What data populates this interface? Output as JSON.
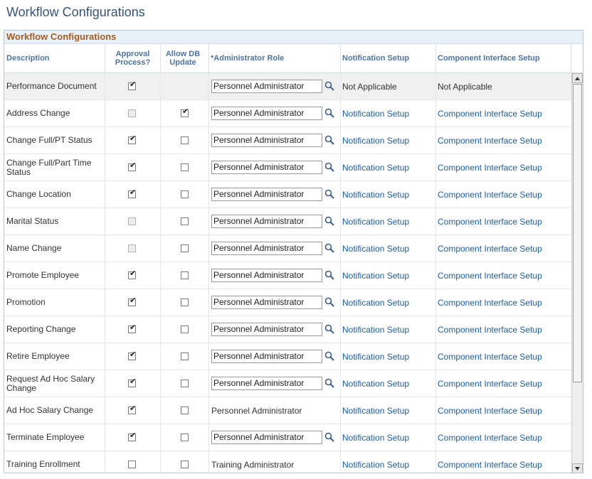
{
  "page": {
    "title": "Workflow Configurations"
  },
  "grid": {
    "title": "Workflow Configurations",
    "headers": {
      "description": "Description",
      "approval_line1": "Approval",
      "approval_line2": "Process?",
      "allow_line1": "Allow DB",
      "allow_line2": "Update",
      "admin_role": "*Administrator Role",
      "notification": "Notification Setup",
      "component": "Component Interface Setup"
    },
    "rows": [
      {
        "desc": "Performance Document",
        "approval": true,
        "approval_disabled": false,
        "allow_db": null,
        "role": "Personnel Administrator",
        "role_editable": true,
        "notification": "Not Applicable",
        "notification_link": false,
        "component": "Not Applicable",
        "component_link": false
      },
      {
        "desc": "Address Change",
        "approval": false,
        "approval_disabled": true,
        "allow_db": true,
        "role": "Personnel Administrator",
        "role_editable": true,
        "notification": "Notification Setup",
        "notification_link": true,
        "component": "Component Interface Setup",
        "component_link": true
      },
      {
        "desc": "Change Full/PT Status",
        "approval": true,
        "approval_disabled": false,
        "allow_db": false,
        "role": "Personnel Administrator",
        "role_editable": true,
        "notification": "Notification Setup",
        "notification_link": true,
        "component": "Component Interface Setup",
        "component_link": true
      },
      {
        "desc": "Change Full/Part Time Status",
        "approval": true,
        "approval_disabled": false,
        "allow_db": false,
        "role": "Personnel Administrator",
        "role_editable": true,
        "notification": "Notification Setup",
        "notification_link": true,
        "component": "Component Interface Setup",
        "component_link": true
      },
      {
        "desc": "Change Location",
        "approval": true,
        "approval_disabled": false,
        "allow_db": false,
        "role": "Personnel Administrator",
        "role_editable": true,
        "notification": "Notification Setup",
        "notification_link": true,
        "component": "Component Interface Setup",
        "component_link": true
      },
      {
        "desc": "Marital Status",
        "approval": false,
        "approval_disabled": true,
        "allow_db": false,
        "role": "Personnel Administrator",
        "role_editable": true,
        "notification": "Notification Setup",
        "notification_link": true,
        "component": "Component Interface Setup",
        "component_link": true
      },
      {
        "desc": "Name Change",
        "approval": false,
        "approval_disabled": true,
        "allow_db": false,
        "role": "Personnel Administrator",
        "role_editable": true,
        "notification": "Notification Setup",
        "notification_link": true,
        "component": "Component Interface Setup",
        "component_link": true
      },
      {
        "desc": "Promote Employee",
        "approval": true,
        "approval_disabled": false,
        "allow_db": false,
        "role": "Personnel Administrator",
        "role_editable": true,
        "notification": "Notification Setup",
        "notification_link": true,
        "component": "Component Interface Setup",
        "component_link": true
      },
      {
        "desc": "Promotion",
        "approval": true,
        "approval_disabled": false,
        "allow_db": false,
        "role": "Personnel Administrator",
        "role_editable": true,
        "notification": "Notification Setup",
        "notification_link": true,
        "component": "Component Interface Setup",
        "component_link": true
      },
      {
        "desc": "Reporting Change",
        "approval": true,
        "approval_disabled": false,
        "allow_db": false,
        "role": "Personnel Administrator",
        "role_editable": true,
        "notification": "Notification Setup",
        "notification_link": true,
        "component": "Component Interface Setup",
        "component_link": true
      },
      {
        "desc": "Retire Employee",
        "approval": true,
        "approval_disabled": false,
        "allow_db": false,
        "role": "Personnel Administrator",
        "role_editable": true,
        "notification": "Notification Setup",
        "notification_link": true,
        "component": "Component Interface Setup",
        "component_link": true
      },
      {
        "desc": "Request Ad Hoc Salary Change",
        "approval": true,
        "approval_disabled": false,
        "allow_db": false,
        "role": "Personnel Administrator",
        "role_editable": true,
        "notification": "Notification Setup",
        "notification_link": true,
        "component": "Component Interface Setup",
        "component_link": true
      },
      {
        "desc": "Ad Hoc Salary Change",
        "approval": true,
        "approval_disabled": false,
        "allow_db": false,
        "role": "Personnel Administrator",
        "role_editable": false,
        "notification": "Notification Setup",
        "notification_link": true,
        "component": "Component Interface Setup",
        "component_link": true
      },
      {
        "desc": "Terminate Employee",
        "approval": true,
        "approval_disabled": false,
        "allow_db": false,
        "role": "Personnel Administrator",
        "role_editable": true,
        "notification": "Notification Setup",
        "notification_link": true,
        "component": "Component Interface Setup",
        "component_link": true
      },
      {
        "desc": "Training Enrollment",
        "approval": false,
        "approval_disabled": false,
        "allow_db": false,
        "role": "Training Administrator",
        "role_editable": false,
        "notification": "Notification Setup",
        "notification_link": true,
        "component": "Component Interface Setup",
        "component_link": true
      }
    ]
  },
  "icons": {
    "lookup": "magnifier-lookup-icon",
    "check": "checkmark-icon",
    "scroll_up": "arrow-up-icon",
    "scroll_down": "arrow-down-icon"
  },
  "colors": {
    "title": "#33547f",
    "grid_title": "#a95c1e",
    "header_text": "#4d74a4",
    "link": "#1b5fa5"
  }
}
